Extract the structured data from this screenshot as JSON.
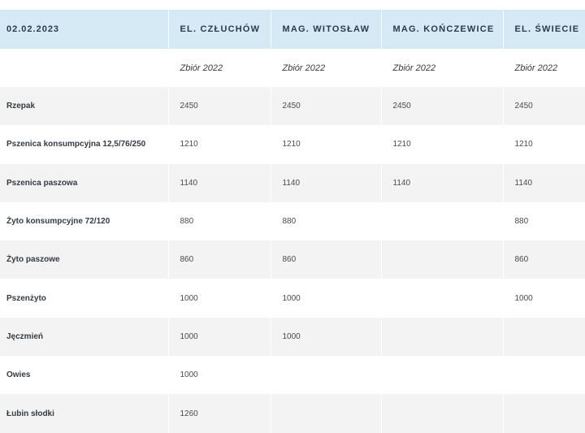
{
  "header": {
    "date": "02.02.2023",
    "columns": [
      "EL. CZŁUCHÓW",
      "MAG. WITOSŁAW",
      "MAG. KOŃCZEWICE",
      "EL. ŚWIECIE"
    ]
  },
  "subheader": [
    "",
    "Zbiór 2022",
    "Zbiór 2022",
    "Zbiór 2022",
    "Zbiór 2022"
  ],
  "rows": [
    {
      "name": "Rzepak",
      "values": [
        "2450",
        "2450",
        "2450",
        "2450"
      ]
    },
    {
      "name": "Pszenica konsumpcyjna 12,5/76/250",
      "values": [
        "1210",
        "1210",
        "1210",
        "1210"
      ]
    },
    {
      "name": "Pszenica paszowa",
      "values": [
        "1140",
        "1140",
        "1140",
        "1140"
      ]
    },
    {
      "name": "Żyto konsumpcyjne 72/120",
      "values": [
        "880",
        "880",
        "",
        "880"
      ]
    },
    {
      "name": "Żyto paszowe",
      "values": [
        "860",
        "860",
        "",
        "860"
      ]
    },
    {
      "name": "Pszenżyto",
      "values": [
        "1000",
        "1000",
        "",
        "1000"
      ]
    },
    {
      "name": "Jęczmień",
      "values": [
        "1000",
        "1000",
        "",
        ""
      ]
    },
    {
      "name": "Owies",
      "values": [
        "1000",
        "",
        "",
        ""
      ]
    },
    {
      "name": "Łubin słodki",
      "values": [
        "1260",
        "",
        "",
        ""
      ]
    }
  ]
}
